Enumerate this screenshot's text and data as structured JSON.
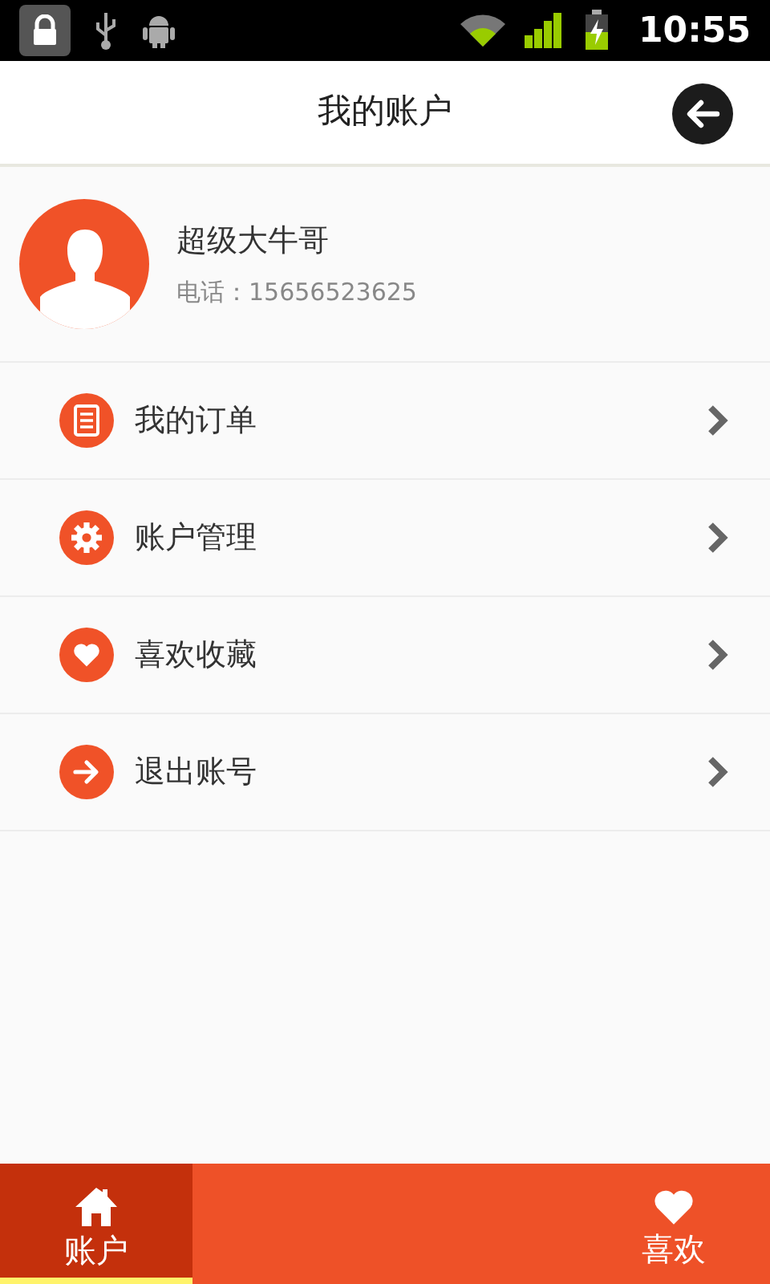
{
  "status_bar": {
    "time": "10:55"
  },
  "header": {
    "title": "我的账户"
  },
  "profile": {
    "name": "超级大牛哥",
    "phone": "电话：15656523625"
  },
  "menu": [
    {
      "kind": "orders",
      "label": "我的订单"
    },
    {
      "kind": "settings",
      "label": "账户管理"
    },
    {
      "kind": "favorites",
      "label": "喜欢收藏"
    },
    {
      "kind": "logout",
      "label": "退出账号"
    }
  ],
  "tabs": [
    {
      "kind": "home",
      "label": "账户",
      "selected": true
    },
    {
      "kind": "heart",
      "label": "喜欢",
      "selected": false
    }
  ]
}
